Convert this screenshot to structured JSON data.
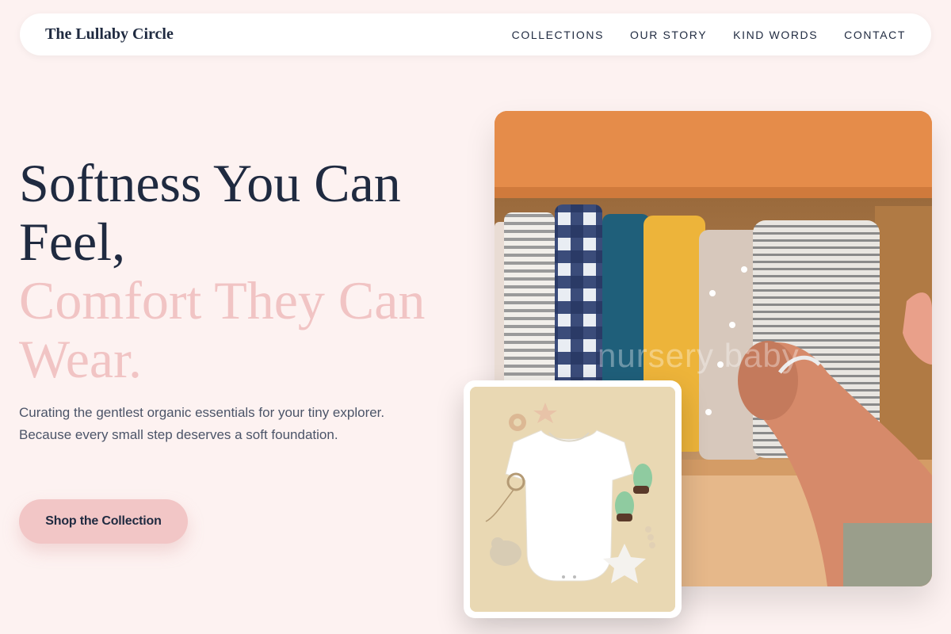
{
  "brand": "The Lullaby Circle",
  "nav": {
    "items": [
      {
        "label": "COLLECTIONS"
      },
      {
        "label": "OUR STORY"
      },
      {
        "label": "KIND WORDS"
      },
      {
        "label": "CONTACT"
      }
    ]
  },
  "hero": {
    "headline_line1": "Softness You Can Feel,",
    "headline_line2": "Comfort They Can Wear.",
    "subtext": "Curating the gentlest organic essentials for your tiny explorer. Because every small step deserves a soft foundation.",
    "cta_label": "Shop the Collection"
  },
  "images": {
    "main_watermark": "nursery baby",
    "main_alt": "Folded muslin blankets in a wooden drawer",
    "secondary_alt": "White baby bodysuit flat lay with accessories"
  },
  "colors": {
    "background": "#fdf2f1",
    "text_dark": "#1f2a40",
    "accent_pink": "#f1c4c4",
    "button_pink": "#f2c6c6"
  }
}
